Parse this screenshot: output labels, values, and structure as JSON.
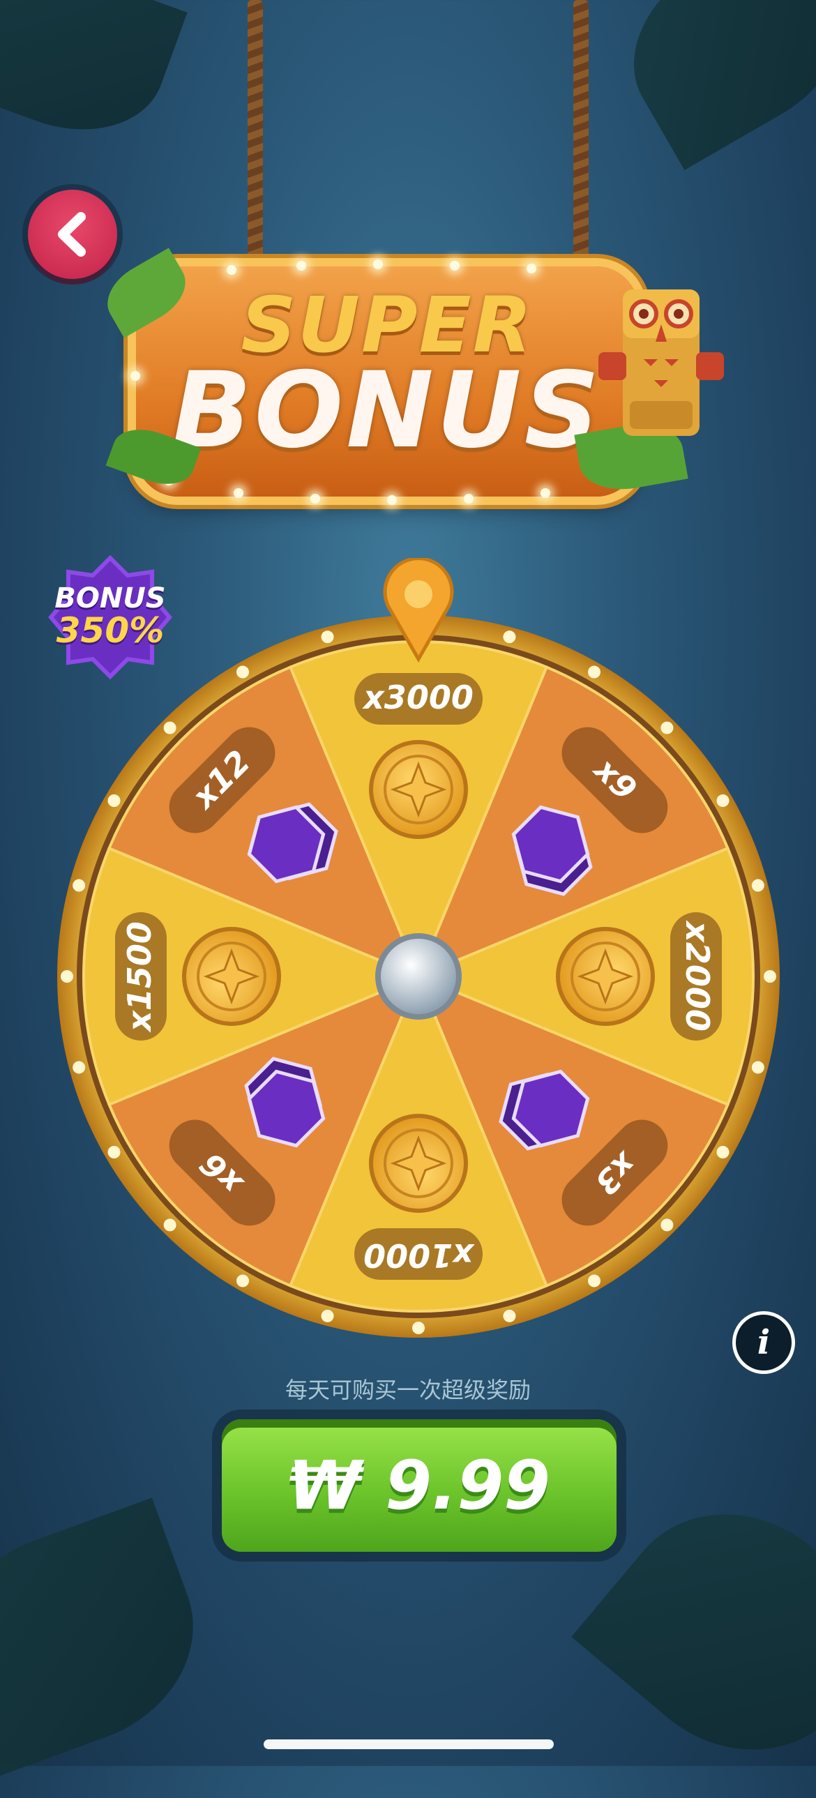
{
  "header": {
    "back_icon": "chevron-left-icon",
    "sign_line1": "SUPER",
    "sign_line2": "BONUS"
  },
  "badge": {
    "line1": "BONUS",
    "line2": "350%"
  },
  "wheel": {
    "segments": [
      {
        "label": "x3000",
        "reward": "coin-icon"
      },
      {
        "label": "x9",
        "reward": "card-pack-icon"
      },
      {
        "label": "x2000",
        "reward": "coin-icon"
      },
      {
        "label": "x3",
        "reward": "card-pack-icon"
      },
      {
        "label": "x1000",
        "reward": "coin-icon"
      },
      {
        "label": "x6",
        "reward": "card-pack-icon"
      },
      {
        "label": "x1500",
        "reward": "coin-icon"
      },
      {
        "label": "x12",
        "reward": "card-pack-icon"
      }
    ]
  },
  "info_icon": "i",
  "notice": "每天可购买一次超级奖励",
  "buy_button": {
    "label": "₩ 9.99"
  },
  "colors": {
    "accent_green": "#6cc52b",
    "back_red": "#d9345a",
    "wheel_gold": "#f2c43a",
    "wheel_orange": "#e58a3a",
    "gem_purple": "#6a2fc2"
  }
}
